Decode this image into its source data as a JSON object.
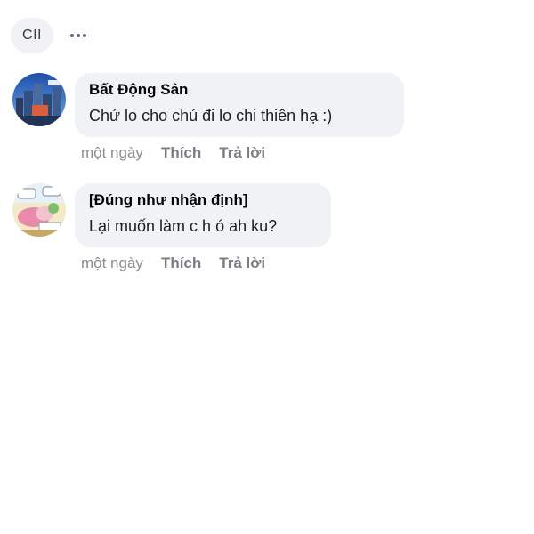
{
  "topbar": {
    "sort_label": "CII",
    "more_icon": "more-horizontal-icon"
  },
  "comments": [
    {
      "author": "Bất Động Sản",
      "text": "Chứ lo cho chú đi lo chi thiên hạ :)",
      "time": "một ngày",
      "like_label": "Thích",
      "reply_label": "Trả lời"
    },
    {
      "author": "[Đúng như nhận định]",
      "text": "Lại muốn làm c h ó ah ku?",
      "time": "một ngày",
      "like_label": "Thích",
      "reply_label": "Trả lời"
    }
  ],
  "colors": {
    "bubble": "#f0f2f5",
    "meta": "#8a8d91",
    "text": "#1c1e21"
  }
}
